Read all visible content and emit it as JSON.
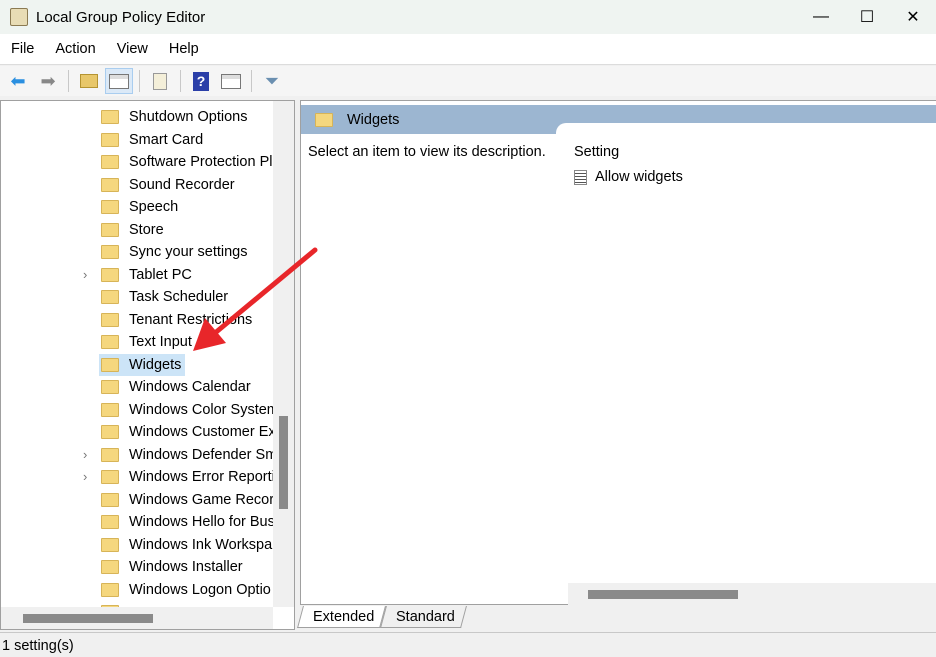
{
  "window": {
    "title": "Local Group Policy Editor",
    "minimize": "—",
    "maximize": "☐",
    "close": "✕"
  },
  "menu": [
    "File",
    "Action",
    "View",
    "Help"
  ],
  "toolbar": [
    "back-icon",
    "forward-icon",
    "up-folder-icon",
    "show-hide-tree-icon",
    "export-list-icon",
    "help-icon",
    "show-action-pane-icon",
    "filter-icon"
  ],
  "tree": [
    {
      "label": "Shutdown Options"
    },
    {
      "label": "Smart Card"
    },
    {
      "label": "Software Protection Pla"
    },
    {
      "label": "Sound Recorder"
    },
    {
      "label": "Speech"
    },
    {
      "label": "Store"
    },
    {
      "label": "Sync your settings"
    },
    {
      "label": "Tablet PC",
      "expandable": true
    },
    {
      "label": "Task Scheduler"
    },
    {
      "label": "Tenant Restrictions"
    },
    {
      "label": "Text Input"
    },
    {
      "label": "Widgets",
      "selected": true
    },
    {
      "label": "Windows Calendar"
    },
    {
      "label": "Windows Color System"
    },
    {
      "label": "Windows Customer Ex"
    },
    {
      "label": "Windows Defender Sm",
      "expandable": true
    },
    {
      "label": "Windows Error Reporti",
      "expandable": true
    },
    {
      "label": "Windows Game Record"
    },
    {
      "label": "Windows Hello for Bus"
    },
    {
      "label": "Windows Ink Workspa"
    },
    {
      "label": "Windows Installer"
    },
    {
      "label": "Windows Logon Optio"
    },
    {
      "label": ""
    }
  ],
  "right": {
    "header": "Widgets",
    "description": "Select an item to view its description.",
    "column": "Setting",
    "settings": [
      "Allow widgets"
    ]
  },
  "tabs": [
    "Extended",
    "Standard"
  ],
  "status": "1 setting(s)",
  "colors": {
    "header_band": "#9cb6d1",
    "selection": "#cce4f7",
    "annotation_arrow": "#e8262a"
  }
}
